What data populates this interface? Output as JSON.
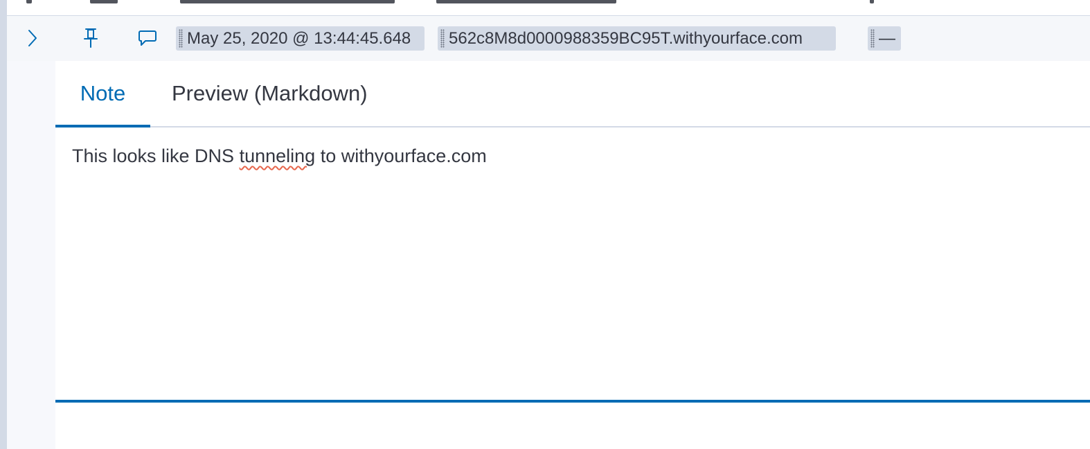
{
  "event_row": {
    "expand_icon": "chevron-right-icon",
    "pin_icon": "pin-icon",
    "note_icon": "comment-icon",
    "timestamp": "May 25, 2020 @ 13:44:45.648",
    "dns_question": "562c8M8d0000988359BC95T.withyourface.com",
    "empty_value": "—"
  },
  "note_editor": {
    "tabs": [
      {
        "label": "Note",
        "active": true
      },
      {
        "label": "Preview (Markdown)",
        "active": false
      }
    ],
    "text_before": "This looks like DNS ",
    "misspelled_word": "tunneling",
    "text_after": " to withyourface.com"
  },
  "colors": {
    "accent": "#006bb4",
    "badge_bg": "#d3dae6",
    "text": "#343741",
    "spellcheck": "#e7664c"
  }
}
